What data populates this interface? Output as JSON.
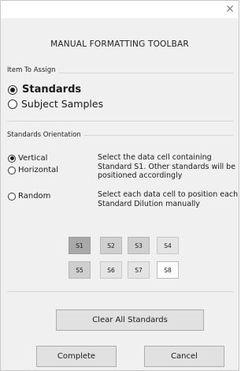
{
  "window": {
    "close_glyph": "✕",
    "close_icon": "close-icon"
  },
  "title": "MANUAL FORMATTING TOOLBAR",
  "item_to_assign": {
    "label": "Item To Assign",
    "options": [
      {
        "label": "Standards",
        "checked": true
      },
      {
        "label": "Subject Samples",
        "checked": false
      }
    ]
  },
  "orientation": {
    "label": "Standards Orientation",
    "options": [
      {
        "label": "Vertical",
        "checked": true
      },
      {
        "label": "Horizontal",
        "checked": false
      },
      {
        "label": "Random",
        "checked": false
      }
    ],
    "desc_linear": "Select the data cell containing Standard S1. Other standards will be positioned accordingly",
    "desc_random": "Select each data cell to position each Standard Dilution manually"
  },
  "standards": [
    {
      "label": "S1",
      "tone": "dark"
    },
    {
      "label": "S2",
      "tone": "mid"
    },
    {
      "label": "S3",
      "tone": "mid"
    },
    {
      "label": "S4",
      "tone": "light"
    },
    {
      "label": "S5",
      "tone": "mid"
    },
    {
      "label": "S6",
      "tone": "light"
    },
    {
      "label": "S7",
      "tone": "light"
    },
    {
      "label": "S8",
      "tone": "white"
    }
  ],
  "buttons": {
    "clear_all": "Clear All Standards",
    "complete": "Complete",
    "cancel": "Cancel"
  },
  "colors": {
    "background": "#f0f0f0",
    "std_dark": "#a8a8a8",
    "std_mid": "#cfcfcf",
    "std_light": "#e4e4e4",
    "std_white": "#ffffff"
  }
}
